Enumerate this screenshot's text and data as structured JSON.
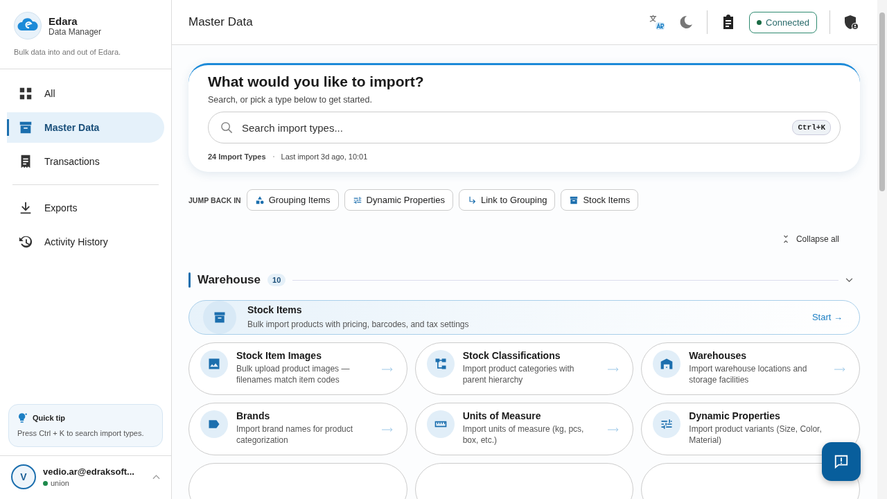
{
  "app": {
    "name": "Edara",
    "subtitle": "Data Manager",
    "tagline": "Bulk data into and out of Edara."
  },
  "nav_groups": [
    [
      {
        "label": "All",
        "selected": false
      },
      {
        "label": "Master Data",
        "selected": true
      },
      {
        "label": "Transactions",
        "selected": false
      }
    ],
    [
      {
        "label": "Exports",
        "selected": false
      },
      {
        "label": "Activity History",
        "selected": false
      }
    ]
  ],
  "tip": {
    "title": "Quick tip",
    "text": "Press Ctrl + K to search import types."
  },
  "user": {
    "initial": "V",
    "email": "vedio.ar@edraksoft...",
    "org": "union",
    "online": true
  },
  "header": {
    "title": "Master Data",
    "status": "Connected"
  },
  "hero": {
    "title": "What would you like to import?",
    "subtitle": "Search, or pick a type below to get started.",
    "search_placeholder": "Search import types...",
    "shortcut": "Ctrl+K",
    "count": "24 Import Types",
    "last_import": "Last import 3d ago, 10:01"
  },
  "jump_back": {
    "label": "JUMP BACK IN",
    "items": [
      {
        "label": "Grouping Items"
      },
      {
        "label": "Dynamic Properties"
      },
      {
        "label": "Link to Grouping"
      },
      {
        "label": "Stock Items"
      }
    ]
  },
  "collapse_label": "Collapse all",
  "section": {
    "title": "Warehouse",
    "count": "10",
    "expanded": true,
    "featured": {
      "title": "Stock Items",
      "description": "Bulk import products with pricing, barcodes, and tax settings",
      "action": "Start →"
    },
    "items": [
      {
        "title": "Stock Item Images",
        "description": "Bulk upload product images — filenames match item codes"
      },
      {
        "title": "Stock Classifications",
        "description": "Import product categories with parent hierarchy"
      },
      {
        "title": "Warehouses",
        "description": "Import warehouse locations and storage facilities"
      },
      {
        "title": "Brands",
        "description": "Import brand names for product categorization"
      },
      {
        "title": "Units of Measure",
        "description": "Import units of measure (kg, pcs, box, etc.)"
      },
      {
        "title": "Dynamic Properties",
        "description": "Import product variants (Size, Color, Material)"
      }
    ]
  }
}
